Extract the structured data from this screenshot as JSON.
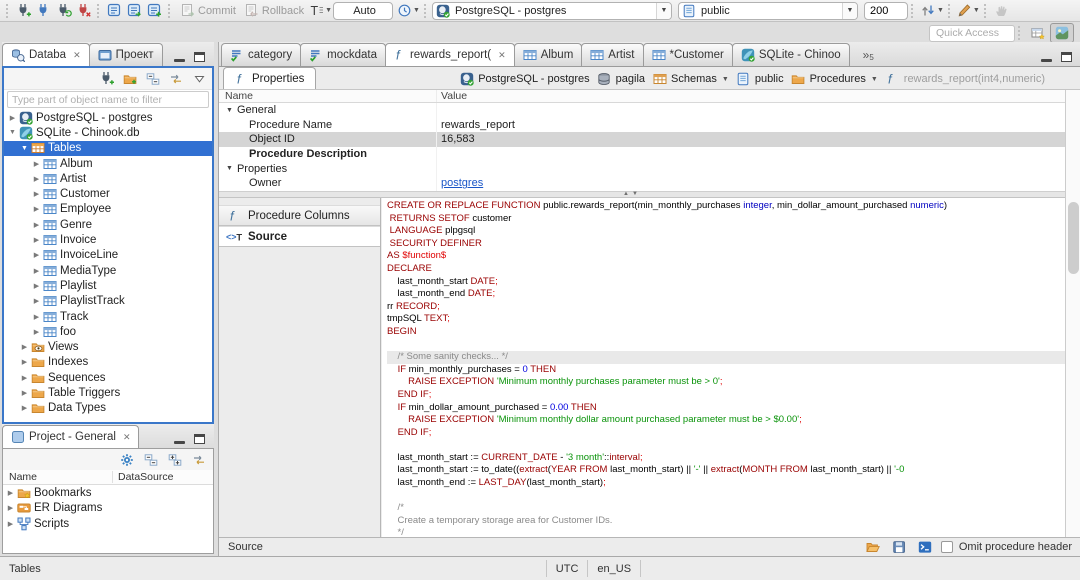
{
  "toolbar": {
    "commit": "Commit",
    "rollback": "Rollback",
    "tx_mode": "Auto",
    "connection": "PostgreSQL - postgres",
    "schema": "public",
    "fetch_size": "200",
    "quick_access": "Quick Access",
    "overflow_count": "5"
  },
  "nav": {
    "tab_database": "Databa",
    "tab_project": "Проект",
    "filter_placeholder": "Type part of object name to filter",
    "tree": [
      {
        "label": "PostgreSQL - postgres",
        "icon": "postgres",
        "level": 0,
        "arrow": "collapsed"
      },
      {
        "label": "SQLite - Chinook.db",
        "icon": "sqlite",
        "level": 0,
        "arrow": "expanded"
      },
      {
        "label": "Tables",
        "icon": "tables-folder",
        "level": 1,
        "arrow": "expanded",
        "selected": true
      },
      {
        "label": "Album",
        "icon": "table",
        "level": 2,
        "arrow": "collapsed"
      },
      {
        "label": "Artist",
        "icon": "table",
        "level": 2,
        "arrow": "collapsed"
      },
      {
        "label": "Customer",
        "icon": "table",
        "level": 2,
        "arrow": "collapsed"
      },
      {
        "label": "Employee",
        "icon": "table",
        "level": 2,
        "arrow": "collapsed"
      },
      {
        "label": "Genre",
        "icon": "table",
        "level": 2,
        "arrow": "collapsed"
      },
      {
        "label": "Invoice",
        "icon": "table",
        "level": 2,
        "arrow": "collapsed"
      },
      {
        "label": "InvoiceLine",
        "icon": "table",
        "level": 2,
        "arrow": "collapsed"
      },
      {
        "label": "MediaType",
        "icon": "table",
        "level": 2,
        "arrow": "collapsed"
      },
      {
        "label": "Playlist",
        "icon": "table",
        "level": 2,
        "arrow": "collapsed"
      },
      {
        "label": "PlaylistTrack",
        "icon": "table",
        "level": 2,
        "arrow": "collapsed"
      },
      {
        "label": "Track",
        "icon": "table",
        "level": 2,
        "arrow": "collapsed"
      },
      {
        "label": "foo",
        "icon": "table",
        "level": 2,
        "arrow": "collapsed"
      },
      {
        "label": "Views",
        "icon": "views-folder",
        "level": 1,
        "arrow": "collapsed"
      },
      {
        "label": "Indexes",
        "icon": "folder",
        "level": 1,
        "arrow": "collapsed"
      },
      {
        "label": "Sequences",
        "icon": "folder",
        "level": 1,
        "arrow": "collapsed"
      },
      {
        "label": "Table Triggers",
        "icon": "folder",
        "level": 1,
        "arrow": "collapsed"
      },
      {
        "label": "Data Types",
        "icon": "folder",
        "level": 1,
        "arrow": "collapsed"
      }
    ]
  },
  "project": {
    "tab": "Project - General",
    "columns": [
      "Name",
      "DataSource"
    ],
    "items": [
      {
        "label": "Bookmarks",
        "icon": "bookmarks-folder"
      },
      {
        "label": "ER Diagrams",
        "icon": "er-diagram"
      },
      {
        "label": "Scripts",
        "icon": "scripts"
      }
    ]
  },
  "editor": {
    "tabs": [
      {
        "label": "category",
        "icon": "sql-file"
      },
      {
        "label": "mockdata",
        "icon": "sql-file"
      },
      {
        "label": "rewards_report(",
        "icon": "function",
        "active": true,
        "closable": true
      },
      {
        "label": "Album",
        "icon": "table"
      },
      {
        "label": "Artist",
        "icon": "table"
      },
      {
        "label": "*Customer",
        "icon": "table"
      },
      {
        "label": "SQLite - Chinoo",
        "icon": "sqlite"
      }
    ],
    "overflow_count": "5",
    "subtab": "Properties",
    "breadcrumb": [
      {
        "label": "PostgreSQL - postgres",
        "icon": "postgres"
      },
      {
        "label": "pagila",
        "icon": "database"
      },
      {
        "label": "Schemas",
        "icon": "schemas",
        "dropdown": true
      },
      {
        "label": "public",
        "icon": "schema-public"
      },
      {
        "label": "Procedures",
        "icon": "folder",
        "dropdown": true
      },
      {
        "label": "rewards_report(int4,numeric)",
        "icon": "function",
        "muted": true
      }
    ],
    "properties": {
      "columns": [
        "Name",
        "Value"
      ],
      "rows": [
        {
          "name": "General",
          "value": "",
          "group": true
        },
        {
          "name": "Procedure Name",
          "value": "rewards_report"
        },
        {
          "name": "Object ID",
          "value": "16,583",
          "selected": true
        },
        {
          "name": "Procedure Description",
          "value": "",
          "bold": true
        },
        {
          "name": "Properties",
          "value": "",
          "group": true
        },
        {
          "name": "Owner",
          "value": "postgres",
          "link": true
        }
      ]
    },
    "side_buttons": [
      {
        "label": "Procedure Columns",
        "icon": "function"
      },
      {
        "label": "Source",
        "icon": "source",
        "active": true
      }
    ],
    "footer": {
      "label": "Source",
      "omit_label": "Omit procedure header"
    }
  },
  "statusbar": {
    "left": "Tables",
    "timezone": "UTC",
    "locale": "en_US"
  },
  "colors": {
    "selection_blue": "#3170d2",
    "focus_border": "#3a77c9",
    "keyword": "#990000",
    "string": "#0a930a",
    "number": "#0000e0",
    "type": "#0000c0",
    "comment": "#8a8a8a",
    "delimiter": "#e00000",
    "link": "#1a56c8"
  },
  "code": {
    "lines": [
      {
        "segs": [
          [
            "k",
            "CREATE OR REPLACE FUNCTION"
          ],
          [
            "p",
            " public.rewards_report(min_monthly_purchases "
          ],
          [
            "t",
            "integer"
          ],
          [
            "p",
            ", min_dollar_amount_purchased "
          ],
          [
            "t",
            "numeric"
          ],
          [
            "p",
            ")"
          ]
        ]
      },
      {
        "segs": [
          [
            "p",
            " "
          ],
          [
            "k",
            "RETURNS SETOF"
          ],
          [
            "p",
            " customer"
          ]
        ]
      },
      {
        "segs": [
          [
            "p",
            " "
          ],
          [
            "k",
            "LANGUAGE"
          ],
          [
            "p",
            " plpgsql"
          ]
        ]
      },
      {
        "segs": [
          [
            "p",
            " "
          ],
          [
            "k",
            "SECURITY DEFINER"
          ]
        ]
      },
      {
        "segs": [
          [
            "k",
            "AS"
          ],
          [
            "p",
            " "
          ],
          [
            "r",
            "$function$"
          ]
        ]
      },
      {
        "segs": [
          [
            "k",
            "DECLARE"
          ]
        ]
      },
      {
        "segs": [
          [
            "p",
            "    last_month_start "
          ],
          [
            "k",
            "DATE"
          ],
          [
            "r",
            ";"
          ]
        ]
      },
      {
        "segs": [
          [
            "p",
            "    last_month_end "
          ],
          [
            "k",
            "DATE"
          ],
          [
            "r",
            ";"
          ]
        ]
      },
      {
        "segs": [
          [
            "p",
            "rr "
          ],
          [
            "k",
            "RECORD"
          ],
          [
            "r",
            ";"
          ]
        ]
      },
      {
        "segs": [
          [
            "p",
            "tmpSQL "
          ],
          [
            "k",
            "TEXT"
          ],
          [
            "r",
            ";"
          ]
        ]
      },
      {
        "segs": [
          [
            "k",
            "BEGIN"
          ]
        ]
      },
      {
        "segs": []
      },
      {
        "segs": [
          [
            "c",
            "    /* Some sanity checks... */"
          ]
        ],
        "highlight": true
      },
      {
        "segs": [
          [
            "p",
            "    "
          ],
          [
            "k",
            "IF"
          ],
          [
            "p",
            " min_monthly_purchases = "
          ],
          [
            "n",
            "0"
          ],
          [
            "p",
            " "
          ],
          [
            "k",
            "THEN"
          ]
        ]
      },
      {
        "segs": [
          [
            "p",
            "        "
          ],
          [
            "k",
            "RAISE EXCEPTION"
          ],
          [
            "p",
            " "
          ],
          [
            "s",
            "'Minimum monthly purchases parameter must be > 0'"
          ],
          [
            "r",
            ";"
          ]
        ]
      },
      {
        "segs": [
          [
            "p",
            "    "
          ],
          [
            "k",
            "END IF"
          ],
          [
            "r",
            ";"
          ]
        ]
      },
      {
        "segs": [
          [
            "p",
            "    "
          ],
          [
            "k",
            "IF"
          ],
          [
            "p",
            " min_dollar_amount_purchased = "
          ],
          [
            "n",
            "0.00"
          ],
          [
            "p",
            " "
          ],
          [
            "k",
            "THEN"
          ]
        ]
      },
      {
        "segs": [
          [
            "p",
            "        "
          ],
          [
            "k",
            "RAISE EXCEPTION"
          ],
          [
            "p",
            " "
          ],
          [
            "s",
            "'Minimum monthly dollar amount purchased parameter must be > $0.00'"
          ],
          [
            "r",
            ";"
          ]
        ]
      },
      {
        "segs": [
          [
            "p",
            "    "
          ],
          [
            "k",
            "END IF"
          ],
          [
            "r",
            ";"
          ]
        ]
      },
      {
        "segs": []
      },
      {
        "segs": [
          [
            "p",
            "    last_month_start := "
          ],
          [
            "k",
            "CURRENT_DATE"
          ],
          [
            "p",
            " - "
          ],
          [
            "s",
            "'3 month'"
          ],
          [
            "p",
            "::"
          ],
          [
            "k",
            "interval"
          ],
          [
            "r",
            ";"
          ]
        ]
      },
      {
        "segs": [
          [
            "p",
            "    last_month_start := to_date(("
          ],
          [
            "k",
            "extract"
          ],
          [
            "p",
            "("
          ],
          [
            "k",
            "YEAR FROM"
          ],
          [
            "p",
            " last_month_start) || "
          ],
          [
            "s",
            "'-'"
          ],
          [
            "p",
            " || "
          ],
          [
            "k",
            "extract"
          ],
          [
            "p",
            "("
          ],
          [
            "k",
            "MONTH FROM"
          ],
          [
            "p",
            " last_month_start) || "
          ],
          [
            "s",
            "'-0"
          ]
        ]
      },
      {
        "segs": [
          [
            "p",
            "    last_month_end := "
          ],
          [
            "k",
            "LAST_DAY"
          ],
          [
            "p",
            "(last_month_start)"
          ],
          [
            "r",
            ";"
          ]
        ]
      },
      {
        "segs": []
      },
      {
        "segs": [
          [
            "c",
            "    /*"
          ]
        ]
      },
      {
        "segs": [
          [
            "c",
            "    Create a temporary storage area for Customer IDs."
          ]
        ]
      },
      {
        "segs": [
          [
            "c",
            "    */"
          ]
        ]
      }
    ]
  }
}
